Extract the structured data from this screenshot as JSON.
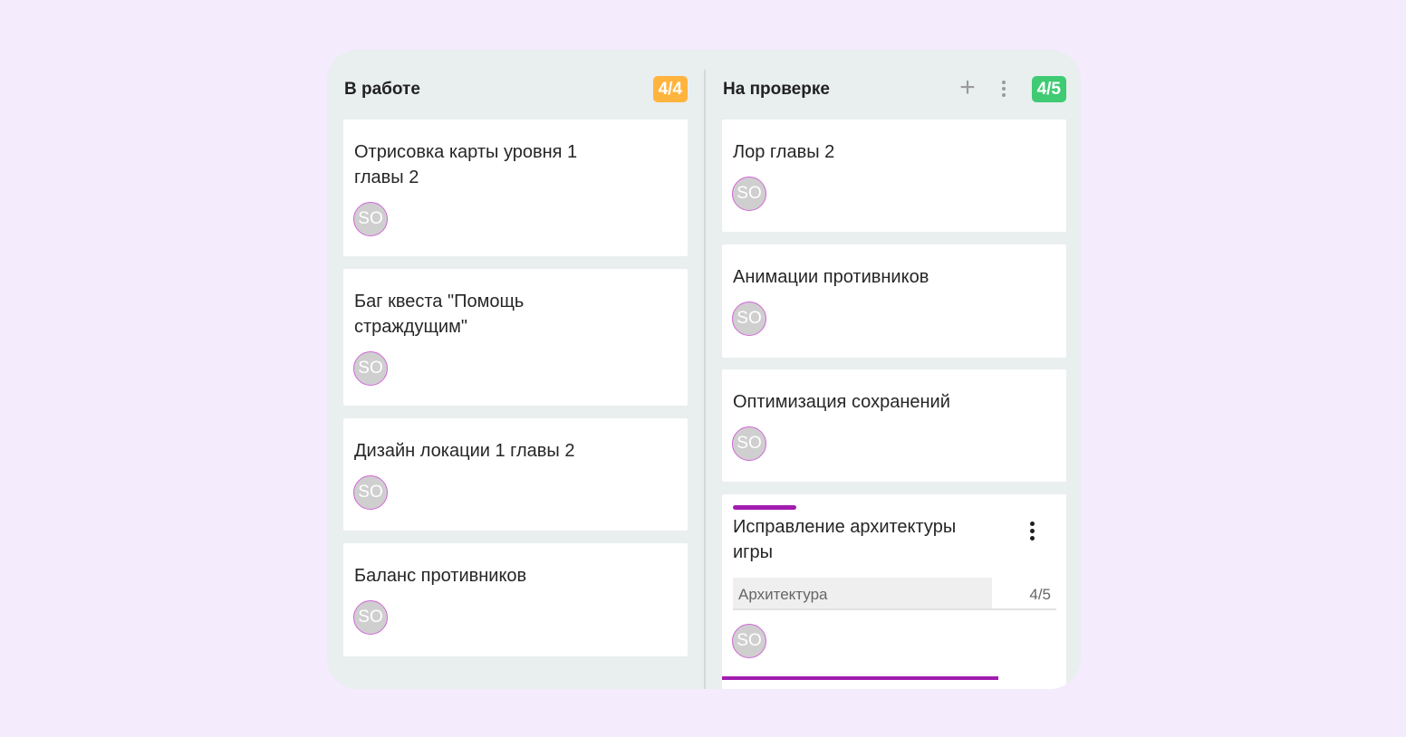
{
  "columns": [
    {
      "title": "В работе",
      "badge": "4/4",
      "badge_color": "#ffb43e",
      "cards": [
        {
          "title": "Отрисовка карты уровня 1 главы 2",
          "avatar": "SO"
        },
        {
          "title": "Баг квеста \"Помощь страждущим\"",
          "avatar": "SO"
        },
        {
          "title": "Дизайн локации 1 главы 2",
          "avatar": "SO"
        },
        {
          "title": "Баланс противников",
          "avatar": "SO"
        }
      ]
    },
    {
      "title": "На проверке",
      "badge": "4/5",
      "badge_color": "#3ecb73",
      "add_icon": "plus-icon",
      "menu_icon": "kebab-vertical-icon",
      "cards": [
        {
          "title": "Лор главы 2",
          "avatar": "SO"
        },
        {
          "title": "Анимации противников",
          "avatar": "SO"
        },
        {
          "title": "Оптимизация сохранений",
          "avatar": "SO"
        },
        {
          "title": "Исправление архитектуры игры",
          "avatar": "SO",
          "accent_color": "#a21caf",
          "menu_icon": "kebab-vertical-icon",
          "progress": {
            "label": "Архитектура",
            "count": "4/5",
            "fraction": 0.8
          }
        }
      ]
    }
  ]
}
